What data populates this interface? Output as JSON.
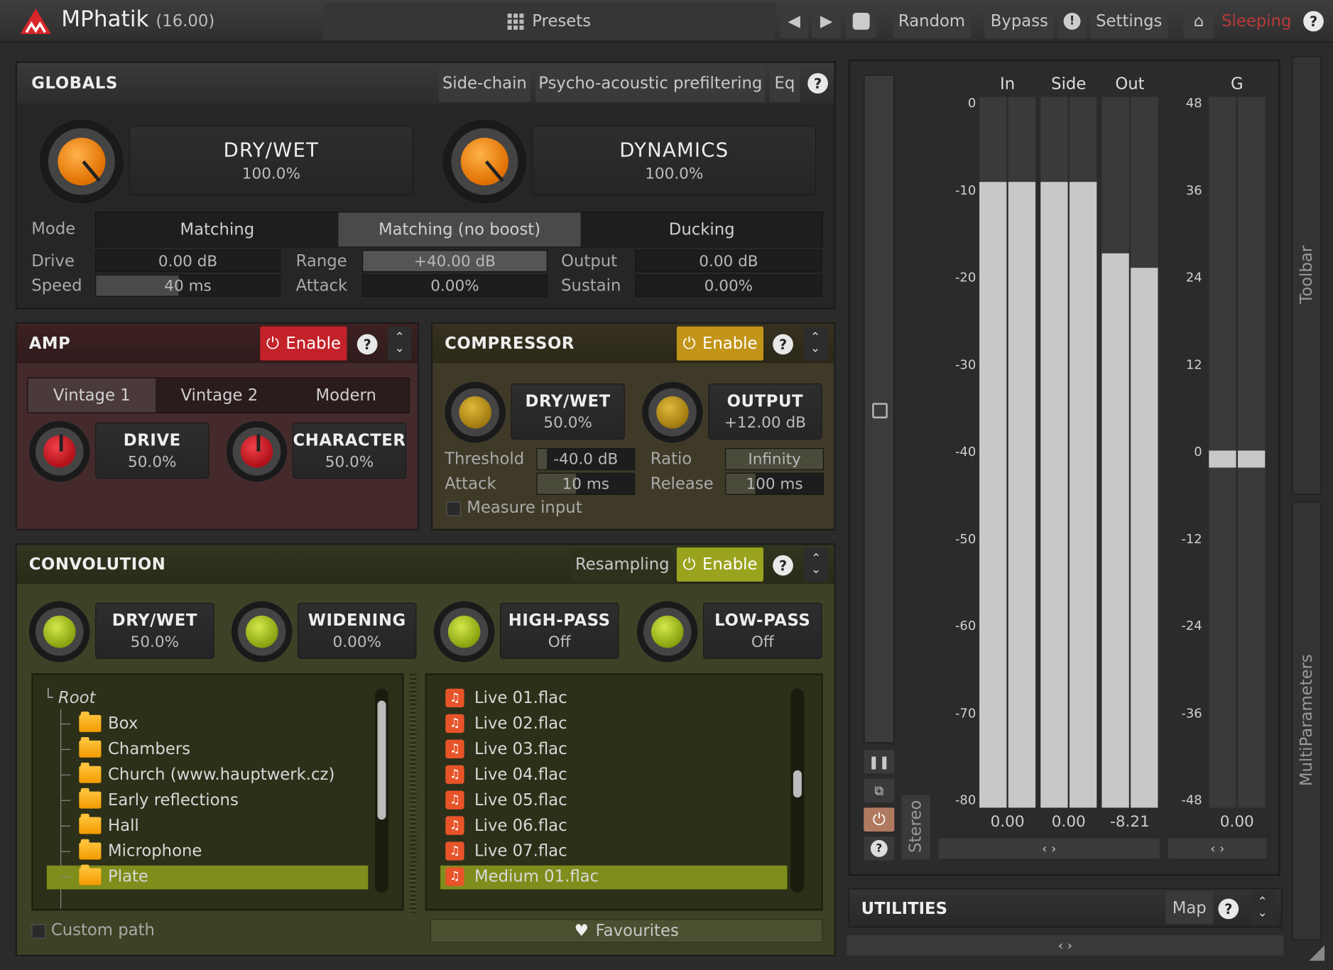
{
  "app": {
    "title": "MPhatik",
    "version": "(16.00)"
  },
  "topbar": {
    "presets": "Presets",
    "random": "Random",
    "bypass": "Bypass",
    "settings": "Settings",
    "sleeping": "Sleeping",
    "help": "?"
  },
  "globals": {
    "title": "GLOBALS",
    "tabs": [
      "Side-chain",
      "Psycho-acoustic prefiltering",
      "Eq"
    ],
    "drywet": {
      "label": "DRY/WET",
      "value": "100.0%"
    },
    "dynamics": {
      "label": "DYNAMICS",
      "value": "100.0%"
    },
    "mode_label": "Mode",
    "modes": [
      "Matching",
      "Matching (no boost)",
      "Ducking"
    ],
    "mode_selected": "Matching (no boost)",
    "params": [
      {
        "label": "Drive",
        "value": "0.00 dB"
      },
      {
        "label": "Range",
        "value": "+40.00 dB"
      },
      {
        "label": "Output",
        "value": "0.00 dB"
      },
      {
        "label": "Speed",
        "value": "40 ms"
      },
      {
        "label": "Attack",
        "value": "0.00%"
      },
      {
        "label": "Sustain",
        "value": "0.00%"
      }
    ]
  },
  "amp": {
    "title": "AMP",
    "enable": "Enable",
    "modes": [
      "Vintage 1",
      "Vintage 2",
      "Modern"
    ],
    "drive": {
      "label": "DRIVE",
      "value": "50.0%"
    },
    "character": {
      "label": "CHARACTER",
      "value": "50.0%"
    }
  },
  "compressor": {
    "title": "COMPRESSOR",
    "enable": "Enable",
    "drywet": {
      "label": "DRY/WET",
      "value": "50.0%"
    },
    "output": {
      "label": "OUTPUT",
      "value": "+12.00 dB"
    },
    "threshold": {
      "label": "Threshold",
      "value": "-40.0 dB"
    },
    "ratio": {
      "label": "Ratio",
      "value": "Infinity"
    },
    "attack": {
      "label": "Attack",
      "value": "10 ms"
    },
    "release": {
      "label": "Release",
      "value": "100 ms"
    },
    "measure": "Measure input"
  },
  "convolution": {
    "title": "CONVOLUTION",
    "resampling": "Resampling",
    "enable": "Enable",
    "knobs": [
      {
        "label": "DRY/WET",
        "value": "50.0%"
      },
      {
        "label": "WIDENING",
        "value": "0.00%"
      },
      {
        "label": "HIGH-PASS",
        "value": "Off"
      },
      {
        "label": "LOW-PASS",
        "value": "Off"
      }
    ],
    "tree_root": "Root",
    "folders": [
      "Box",
      "Chambers",
      "Church (www.hauptwerk.cz)",
      "Early reflections",
      "Hall",
      "Microphone",
      "Plate"
    ],
    "files": [
      "Live 01.flac",
      "Live 02.flac",
      "Live 03.flac",
      "Live 04.flac",
      "Live 05.flac",
      "Live 06.flac",
      "Live 07.flac",
      "Medium 01.flac"
    ],
    "custom_path": "Custom path",
    "favourites": "Favourites"
  },
  "meters": {
    "headers": [
      "In",
      "Side",
      "Out",
      "G"
    ],
    "scale_left": [
      "0",
      "-10",
      "-20",
      "-30",
      "-40",
      "-50",
      "-60",
      "-70",
      "-80"
    ],
    "scale_right": [
      "48",
      "36",
      "24",
      "12",
      "0",
      "-12",
      "-24",
      "-36",
      "-48"
    ],
    "readouts": [
      "0.00",
      "0.00",
      "-8.21",
      "0.00"
    ],
    "stereo": "Stereo",
    "arrows": "‹ ›",
    "levels": {
      "in_l": 0.88,
      "in_r": 0.88,
      "side_l": 0.88,
      "side_r": 0.88,
      "out_l": 0.78,
      "out_r": 0.76
    },
    "colors": {
      "fill": "#c8c8c8",
      "track": "#3a3a3a"
    }
  },
  "utilities": {
    "title": "UTILITIES",
    "map": "Map"
  },
  "side": {
    "toolbar": "Toolbar",
    "multiparameters": "MultiParameters"
  },
  "colors": {
    "accent_red": "#c4222a",
    "accent_yellow": "#c29418",
    "accent_olive": "#99a31e",
    "sleeping": "#b73a3a",
    "selected_row": "#7e8d1b"
  }
}
